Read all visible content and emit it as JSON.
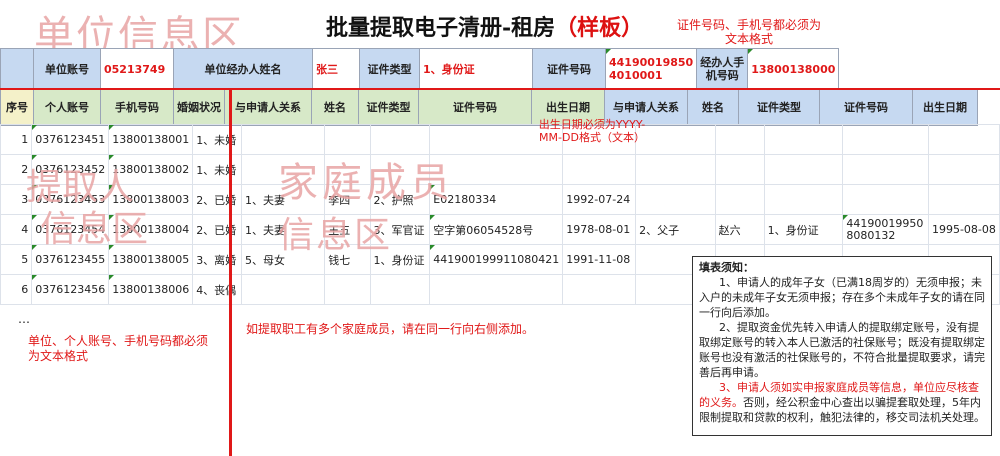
{
  "watermarks": {
    "unit": "单位信息区",
    "applicant_1": "提取人",
    "applicant_2": "信息区",
    "family_1": "家庭成员",
    "family_2": "信息区"
  },
  "title": {
    "main": "批量提取电子清册-租房",
    "sample": "（样板）"
  },
  "note_top": "证件号码、手机号都必须为文本格式",
  "unit_row": {
    "account_label": "单位账号",
    "account_value": "05213749",
    "handler_label": "单位经办人姓名",
    "handler_value": "张三",
    "idtype_label": "证件类型",
    "idtype_value": "1、身份证",
    "idno_label": "证件号码",
    "idno_value_1": "44190019850",
    "idno_value_2": "4010001",
    "phone_label_1": "经办人手",
    "phone_label_2": "机号码",
    "phone_value": "13800138000"
  },
  "headers": [
    "序号",
    "个人账号",
    "手机号码",
    "婚姻状况",
    "与申请人关系",
    "姓名",
    "证件类型",
    "证件号码",
    "出生日期",
    "与申请人关系",
    "姓名",
    "证件类型",
    "证件号码",
    "出生日期"
  ],
  "rows": [
    {
      "no": "1",
      "acct": "0376123451",
      "phone": "13800138001",
      "marital": "1、未婚",
      "rel": "",
      "name": "",
      "idtype": "",
      "idno": "",
      "dob": "",
      "rel2": "",
      "name2": "",
      "idtype2": "",
      "idno2": "",
      "dob2": ""
    },
    {
      "no": "2",
      "acct": "0376123452",
      "phone": "13800138002",
      "marital": "1、未婚",
      "rel": "",
      "name": "",
      "idtype": "",
      "idno": "",
      "dob": "",
      "rel2": "",
      "name2": "",
      "idtype2": "",
      "idno2": "",
      "dob2": ""
    },
    {
      "no": "3",
      "acct": "0376123453",
      "phone": "13800138003",
      "marital": "2、已婚",
      "rel": "1、夫妻",
      "name": "李四",
      "idtype": "2、护照",
      "idno": "E02180334",
      "dob": "1992-07-24",
      "rel2": "",
      "name2": "",
      "idtype2": "",
      "idno2": "",
      "dob2": ""
    },
    {
      "no": "4",
      "acct": "0376123454",
      "phone": "13800138004",
      "marital": "2、已婚",
      "rel": "1、夫妻",
      "name": "王五",
      "idtype": "3、军官证",
      "idno": "空字第06054528号",
      "dob": "1978-08-01",
      "rel2": "2、父子",
      "name2": "赵六",
      "idtype2": "1、身份证",
      "idno2": "441900199508080132",
      "dob2": "1995-08-08"
    },
    {
      "no": "5",
      "acct": "0376123455",
      "phone": "13800138005",
      "marital": "3、离婚",
      "rel": "5、母女",
      "name": "钱七",
      "idtype": "1、身份证",
      "idno": "441900199911080421",
      "dob": "1991-11-08",
      "rel2": "",
      "name2": "",
      "idtype2": "",
      "idno2": "",
      "dob2": ""
    },
    {
      "no": "6",
      "acct": "0376123456",
      "phone": "13800138006",
      "marital": "4、丧偶",
      "rel": "",
      "name": "",
      "idtype": "",
      "idno": "",
      "dob": "",
      "rel2": "",
      "name2": "",
      "idtype2": "",
      "idno2": "",
      "dob2": ""
    }
  ],
  "ellipsis": "…",
  "note_dob": "出生日期必须为YYYY-MM-DD格式（文本）",
  "note_unit": "单位、个人账号、手机号码都必须为文本格式",
  "note_add": "如提取职工有多个家庭成员，请在同一行向右侧添加。",
  "instructions": {
    "title": "填表须知：",
    "p1": "1、申请人的成年子女（已满18周岁的）无须申报；未入户的未成年子女无须申报；存在多个未成年子女的请在同一行向后添加。",
    "p2": "2、提取资金优先转入申请人的提取绑定账号，没有提取绑定账号的转入本人已激活的社保账号；既没有提取绑定账号也没有激活的社保账号的，不符合批量提取要求，请完善后再申请。",
    "p3_red": "3、申请人须如实申报家庭成员等信息，单位应尽核查的义务。",
    "p3_rest": "否则，经公积金中心查出以骗提套取处理，5年内限制提取和贷款的权利，触犯法律的，移交司法机关处理。"
  }
}
